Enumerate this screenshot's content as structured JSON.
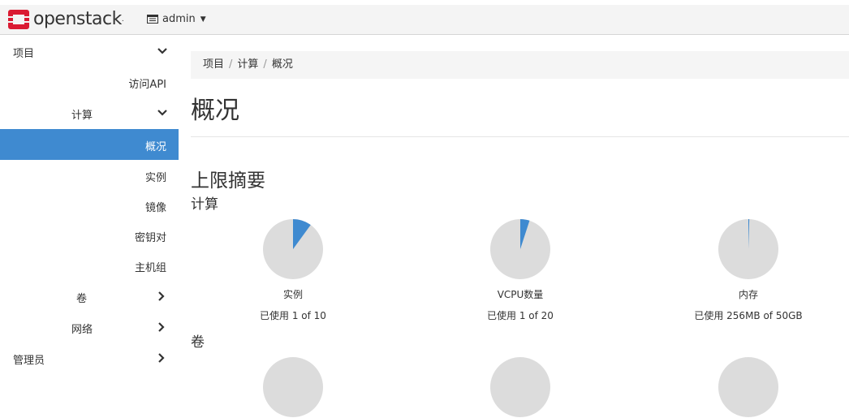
{
  "brand": {
    "name": "openstack",
    "tm": "."
  },
  "project_selector": {
    "label": "admin"
  },
  "sidebar": {
    "items": [
      {
        "label": "项目",
        "chevron": "down"
      },
      {
        "label": "访问API"
      },
      {
        "label": "计算",
        "chevron": "down"
      },
      {
        "label": "概况",
        "active": true
      },
      {
        "label": "实例"
      },
      {
        "label": "镜像"
      },
      {
        "label": "密钥对"
      },
      {
        "label": "主机组"
      },
      {
        "label": "卷",
        "chevron": "right"
      },
      {
        "label": "网络",
        "chevron": "right"
      },
      {
        "label": "管理员",
        "chevron": "right"
      }
    ]
  },
  "breadcrumb": [
    "项目",
    "计算",
    "概况"
  ],
  "page": {
    "title": "概况",
    "section_title": "上限摘要",
    "groups": [
      {
        "title": "计算",
        "pies": [
          {
            "label": "实例",
            "usage": "已使用 1 of 10",
            "used": 1,
            "total": 10
          },
          {
            "label": "VCPU数量",
            "usage": "已使用 1 of 20",
            "used": 1,
            "total": 20
          },
          {
            "label": "内存",
            "usage": "已使用 256MB of 50GB",
            "used": 256,
            "total": 51200
          }
        ]
      },
      {
        "title": "卷"
      }
    ]
  },
  "colors": {
    "accent": "#3f8ad0",
    "pie_bg": "#dcdcdc",
    "logo_red": "#da1a32"
  }
}
